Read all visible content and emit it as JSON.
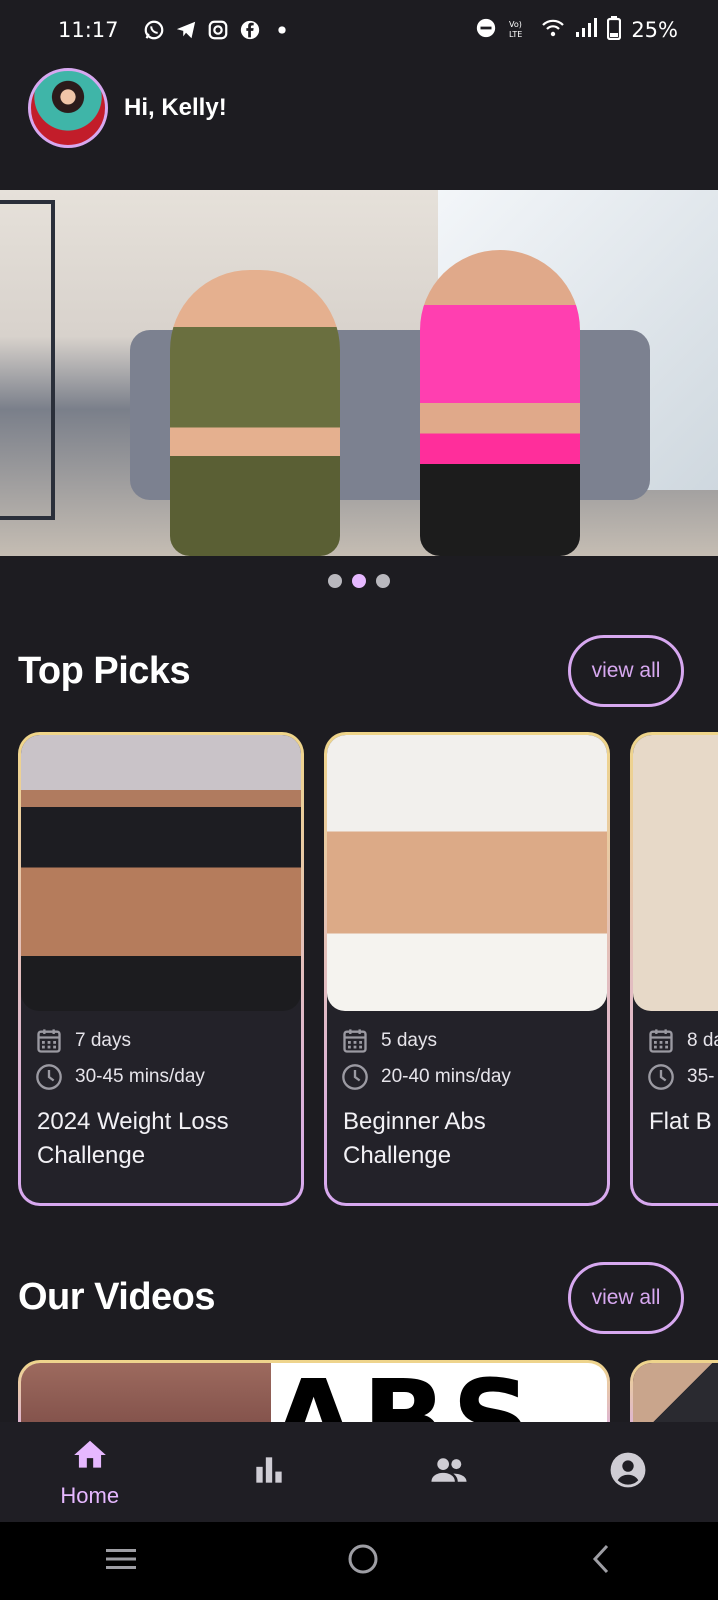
{
  "status_bar": {
    "time": "11:17",
    "battery": "25%",
    "left_icons": [
      "whatsapp-icon",
      "telegram-icon",
      "instagram-icon",
      "facebook-icon",
      "dot-icon"
    ],
    "right_icons": [
      "dnd-icon",
      "volte-icon",
      "wifi-icon",
      "signal-icon",
      "battery-icon"
    ]
  },
  "header": {
    "greeting": "Hi, Kelly!"
  },
  "carousel": {
    "page_count": 3,
    "active_index": 1
  },
  "top_picks": {
    "title": "Top Picks",
    "view_all_label": "view all",
    "cards": [
      {
        "duration": "7 days",
        "time": "30-45 mins/day",
        "title": "2024 Weight Loss Challenge"
      },
      {
        "duration": "5 days",
        "time": "20-40 mins/day",
        "title": "Beginner Abs Challenge"
      },
      {
        "duration": "8 da",
        "time": "35-",
        "title": "Flat B"
      }
    ]
  },
  "our_videos": {
    "title": "Our Videos",
    "view_all_label": "view all",
    "first_video_text": "ABS"
  },
  "bottom_nav": {
    "items": [
      {
        "label": "Home",
        "icon": "home-icon",
        "active": true
      },
      {
        "label": "",
        "icon": "stats-icon",
        "active": false
      },
      {
        "label": "",
        "icon": "community-icon",
        "active": false
      },
      {
        "label": "",
        "icon": "profile-icon",
        "active": false
      }
    ]
  },
  "colors": {
    "background": "#1d1c21",
    "accent": "#d7a8f0",
    "active_nav": "#e6b8ff",
    "card_border_top": "#efd58a"
  }
}
